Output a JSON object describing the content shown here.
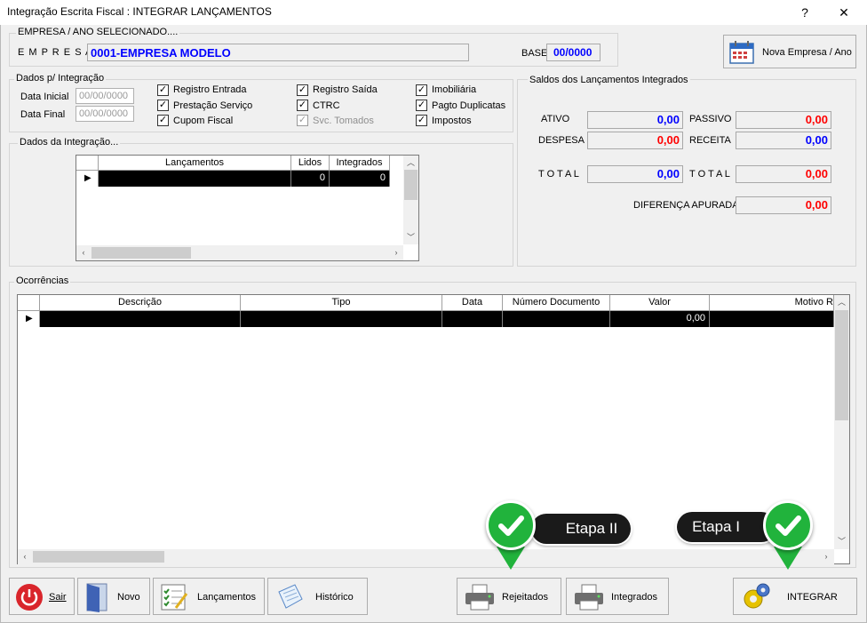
{
  "window": {
    "title": "Integração Escrita Fiscal : INTEGRAR LANÇAMENTOS",
    "help": "?",
    "close": "✕"
  },
  "empresa": {
    "header": "EMPRESA  /  ANO  SELECIONADO....",
    "label": "E M P R E S A",
    "value": "0001-EMPRESA MODELO",
    "base_label": "BASE",
    "base_value": "00/0000"
  },
  "nova_empresa": {
    "label": "Nova Empresa / Ano"
  },
  "dados_integracao": {
    "title": "Dados p/ Integração",
    "data_inicial_label": "Data Inicial",
    "data_inicial_value": "00/00/0000",
    "data_final_label": "Data Final",
    "data_final_value": "00/00/0000",
    "checks": [
      {
        "label": "Registro Entrada",
        "checked": "✓"
      },
      {
        "label": "Prestação Serviço",
        "checked": "✓"
      },
      {
        "label": "Cupom Fiscal",
        "checked": "✓"
      },
      {
        "label": "Registro Saída",
        "checked": "✓"
      },
      {
        "label": "CTRC",
        "checked": "✓"
      },
      {
        "label": "Svc. Tomados",
        "checked": "✓"
      },
      {
        "label": "Imobiliária",
        "checked": "✓"
      },
      {
        "label": "Pagto Duplicatas",
        "checked": "✓"
      },
      {
        "label": "Impostos",
        "checked": "✓"
      }
    ]
  },
  "dados_da_integracao": {
    "title": "Dados da Integração...",
    "columns": [
      "Lançamentos",
      "Lidos",
      "Integrados"
    ],
    "row": {
      "lancamentos": "",
      "lidos": "0",
      "integrados": "0"
    }
  },
  "saldos": {
    "title": "Saldos dos Lançamentos Integrados",
    "ativo_label": "ATIVO",
    "ativo_value": "0,00",
    "passivo_label": "PASSIVO",
    "passivo_value": "0,00",
    "despesa_label": "DESPESA",
    "despesa_value": "0,00",
    "receita_label": "RECEITA",
    "receita_value": "0,00",
    "total1_label": "T O T A L",
    "total1_value": "0,00",
    "total2_label": "T O T A L",
    "total2_value": "0,00",
    "diferenca_label": "DIFERENÇA APURADA",
    "diferenca_value": "0,00",
    "colors": {
      "blue": "#0000ff",
      "red": "#ff0000"
    }
  },
  "ocorrencias": {
    "title": "Ocorrências",
    "columns": [
      "Descrição",
      "Tipo",
      "Data",
      "Número Documento",
      "Valor",
      "Motivo R"
    ],
    "row": {
      "valor": "0,00"
    }
  },
  "callouts": {
    "etapa2": "Etapa II",
    "etapa1": "Etapa I",
    "accent": "#21b33c"
  },
  "toolbar": {
    "sair": "Sair",
    "novo": "Novo",
    "lancamentos": "Lançamentos",
    "historico": "Histórico",
    "rejeitados": "Rejeitados",
    "integrados": "Integrados",
    "integrar": "INTEGRAR"
  }
}
